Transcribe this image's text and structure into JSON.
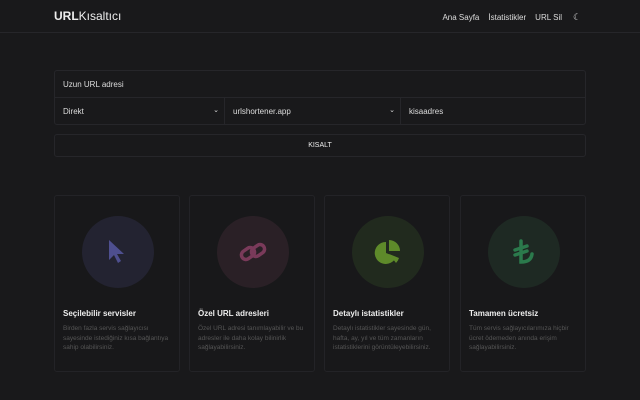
{
  "header": {
    "logo_bold": "URL",
    "logo_light": "Kısaltıcı",
    "nav": [
      "Ana Sayfa",
      "İstatistikler",
      "URL Sil"
    ],
    "theme_icon": "moon-icon"
  },
  "form": {
    "url_placeholder": "Uzun URL adresi",
    "type_select": "Direkt",
    "domain_select": "urlshortener.app",
    "alias_value": "kisaadres",
    "submit": "KISALT"
  },
  "features": [
    {
      "title": "Seçilebilir servisler",
      "desc": "Birden fazla servis sağlayıcısı sayesinde istediğiniz kısa bağlantıya sahip olabilirsiniz.",
      "icon": "cursor-icon",
      "color": "#4e4f8f",
      "bg": "#232331"
    },
    {
      "title": "Özel URL adresleri",
      "desc": "Özel URL adresi tanımlayabilir ve bu adresler ile daha kolay bilinirlik sağlayabilirsiniz.",
      "icon": "link-icon",
      "color": "#7a3a5a",
      "bg": "#2a2026"
    },
    {
      "title": "Detaylı istatistikler",
      "desc": "Detaylı istatistikler sayesinde gün, hafta, ay, yıl ve tüm zamanların istatistiklerini görüntüleyebilirsiniz.",
      "icon": "pie-chart-icon",
      "color": "#5e8a2a",
      "bg": "#212a1e"
    },
    {
      "title": "Tamamen ücretsiz",
      "desc": "Tüm servis sağlayıcılarımıza hiçbir ücret ödemeden anında erişim sağlayabilirsiniz.",
      "icon": "lira-icon",
      "color": "#2b7a4c",
      "bg": "#1e2923"
    }
  ]
}
